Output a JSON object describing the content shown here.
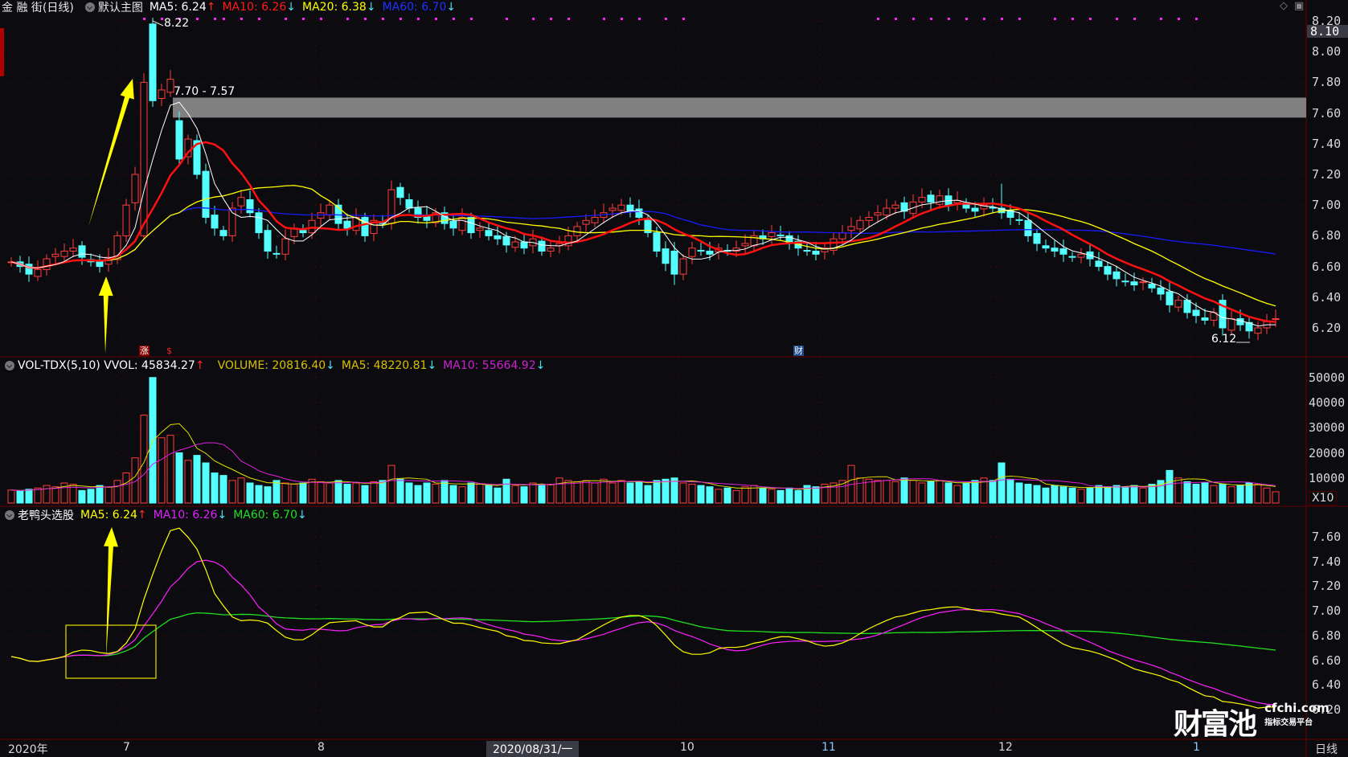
{
  "header": {
    "stock": "金 融 街(日线)",
    "template": "默认主图",
    "ma5": "MA5: 6.24",
    "ma5_dir": "↑",
    "ma10": "MA10: 6.26",
    "ma10_dir": "↓",
    "ma20": "MA20: 6.38",
    "ma20_dir": "↓",
    "ma60": "MA60: 6.70",
    "ma60_dir": "↓",
    "top_icons": [
      "◇",
      "▣"
    ]
  },
  "volume_header": {
    "name": "VOL-TDX(5,10) VVOL: 45834.27",
    "name_dir": "↑",
    "volume": "VOLUME: 20816.40",
    "volume_dir": "↓",
    "ma5": "MA5: 48220.81",
    "ma5_dir": "↓",
    "ma10": "MA10: 55664.92",
    "ma10_dir": "↓"
  },
  "indicator_header": {
    "name": "老鸭头选股",
    "ma5": "MA5: 6.24",
    "ma5_dir": "↑",
    "ma10": "MA10: 6.26",
    "ma10_dir": "↓",
    "ma60": "MA60: 6.70",
    "ma60_dir": "↓"
  },
  "price_axis": [
    "8.20",
    "8.00",
    "7.80",
    "7.60",
    "7.40",
    "7.20",
    "7.00",
    "6.80",
    "6.60",
    "6.40",
    "6.20"
  ],
  "current_price_tag": "8.10",
  "volume_axis": [
    "50000",
    "40000",
    "30000",
    "20000",
    "10000"
  ],
  "volume_unit": "X10",
  "indicator_axis": [
    "7.60",
    "7.40",
    "7.20",
    "7.00",
    "6.80",
    "6.60",
    "6.40",
    "6.20"
  ],
  "date_axis": {
    "year": "2020年",
    "months": [
      {
        "label": "7",
        "index": 13
      },
      {
        "label": "8",
        "index": 35
      },
      {
        "label": "10",
        "index": 76
      },
      {
        "label": "11",
        "index": 92
      },
      {
        "label": "12",
        "index": 112
      },
      {
        "label": "1",
        "index": 134
      }
    ],
    "cursor_date": "2020/08/31/一",
    "period": "日线"
  },
  "annotations": {
    "high_label": "8.22",
    "band_label": "7.70 - 7.57",
    "band_top": 7.7,
    "band_bottom": 7.57,
    "low_label": "6.12"
  },
  "event_markers": [
    {
      "label": "涨",
      "index": 15,
      "color": "#8b0000"
    },
    {
      "label": "$",
      "index": 18,
      "color": "#ff2020"
    },
    {
      "label": "财",
      "index": 89,
      "color": "#1c4a8a"
    }
  ],
  "signal_dots": [
    15,
    17,
    19,
    21,
    23,
    24,
    26,
    28,
    31,
    33,
    35,
    38,
    40,
    42,
    44,
    46,
    48,
    50,
    52,
    56,
    59,
    61,
    63,
    67,
    69,
    71,
    74,
    76,
    98,
    100,
    102,
    104,
    106,
    108,
    110,
    112,
    114,
    118,
    120,
    122,
    125,
    127,
    130,
    132,
    134
  ],
  "watermark": {
    "brand": "财富池",
    "site": "cfchi.com",
    "tagline": "指标交易平台"
  },
  "colors": {
    "up": "#ff3c3c",
    "down": "#54ffff",
    "ma5": "#ffffff",
    "ma10": "#ff1010",
    "ma20": "#ffff00",
    "ma60": "#1a1aff",
    "vol_ma5": "#e0e000",
    "vol_ma10": "#e020e0",
    "ind_ma5": "#ffff00",
    "ind_ma10": "#ff20ff",
    "ind_ma60": "#20e020"
  },
  "chart_data": {
    "type": "candlestick",
    "closes": [
      6.63,
      6.6,
      6.55,
      6.58,
      6.65,
      6.68,
      6.7,
      6.72,
      6.66,
      6.63,
      6.6,
      6.66,
      6.8,
      7.0,
      7.2,
      7.8,
      7.68,
      7.75,
      7.82,
      7.3,
      7.43,
      7.2,
      6.92,
      6.85,
      6.8,
      6.98,
      7.05,
      6.95,
      6.82,
      6.7,
      6.68,
      6.78,
      6.85,
      6.82,
      6.9,
      6.95,
      7.0,
      6.88,
      6.85,
      6.92,
      6.8,
      6.9,
      6.88,
      7.1,
      7.05,
      6.98,
      6.92,
      6.9,
      6.95,
      6.88,
      6.85,
      6.92,
      6.82,
      6.85,
      6.8,
      6.78,
      6.74,
      6.76,
      6.72,
      6.78,
      6.7,
      6.72,
      6.75,
      6.8,
      6.86,
      6.9,
      6.92,
      6.95,
      6.98,
      7.0,
      6.96,
      6.92,
      6.82,
      6.7,
      6.62,
      6.55,
      6.65,
      6.72,
      6.7,
      6.68,
      6.72,
      6.7,
      6.72,
      6.75,
      6.8,
      6.78,
      6.82,
      6.8,
      6.75,
      6.72,
      6.7,
      6.68,
      6.72,
      6.78,
      6.82,
      6.86,
      6.9,
      6.92,
      6.95,
      6.98,
      7.0,
      6.96,
      7.02,
      7.05,
      7.02,
      7.06,
      7.0,
      7.03,
      6.98,
      6.96,
      7.0,
      6.98,
      6.95,
      6.92,
      6.9,
      6.8,
      6.75,
      6.72,
      6.7,
      6.68,
      6.66,
      6.68,
      6.65,
      6.6,
      6.55,
      6.52,
      6.5,
      6.48,
      6.5,
      6.46,
      6.42,
      6.35,
      6.38,
      6.3,
      6.28,
      6.25,
      6.3,
      6.2,
      6.26,
      6.22,
      6.18,
      6.2,
      6.24,
      6.26
    ],
    "open_overrides": {
      "15": 6.8,
      "16": 8.18,
      "19": 7.55,
      "21": 7.42,
      "22": 7.22,
      "75": 6.7,
      "137": 6.38
    },
    "high_overrides": {
      "16": 8.22,
      "18": 7.88,
      "112": 7.14
    },
    "low_overrides": {
      "141": 6.12,
      "75": 6.48
    },
    "volumes": [
      5200,
      4800,
      5500,
      6000,
      7000,
      6500,
      8000,
      7500,
      5000,
      5500,
      7000,
      6500,
      9000,
      12000,
      18000,
      35000,
      50000,
      26000,
      27000,
      20000,
      17000,
      19000,
      16000,
      12000,
      11000,
      9000,
      10000,
      8000,
      7000,
      6500,
      9000,
      8000,
      7500,
      8000,
      9500,
      8500,
      8000,
      9000,
      7500,
      8000,
      7000,
      8500,
      9000,
      15000,
      9500,
      8000,
      7000,
      8000,
      7500,
      9000,
      7000,
      6500,
      8000,
      7500,
      7000,
      6000,
      9500,
      7000,
      6500,
      8000,
      7000,
      7500,
      10000,
      9000,
      8500,
      9000,
      8000,
      9500,
      8000,
      9000,
      8000,
      8500,
      7000,
      9000,
      9500,
      10000,
      8000,
      7500,
      7000,
      6500,
      5500,
      6000,
      5000,
      6500,
      7000,
      6000,
      5500,
      5000,
      6000,
      5000,
      7000,
      6500,
      7500,
      8000,
      9000,
      15000,
      10000,
      9500,
      9000,
      9000,
      8500,
      10000,
      9000,
      8000,
      8500,
      9000,
      8000,
      7000,
      8000,
      9000,
      10000,
      9000,
      16000,
      9500,
      8000,
      7500,
      7000,
      6000,
      7000,
      6500,
      6000,
      5500,
      6000,
      7000,
      6500,
      7000,
      6500,
      7000,
      6000,
      7500,
      9000,
      13000,
      10000,
      8500,
      7500,
      8000,
      7000,
      7500,
      6500,
      7000,
      8000,
      7500,
      6000,
      4500
    ],
    "price_range": [
      6.1,
      8.22
    ],
    "volume_range": [
      0,
      52000
    ],
    "indicator_range": [
      6.15,
      7.75
    ]
  }
}
